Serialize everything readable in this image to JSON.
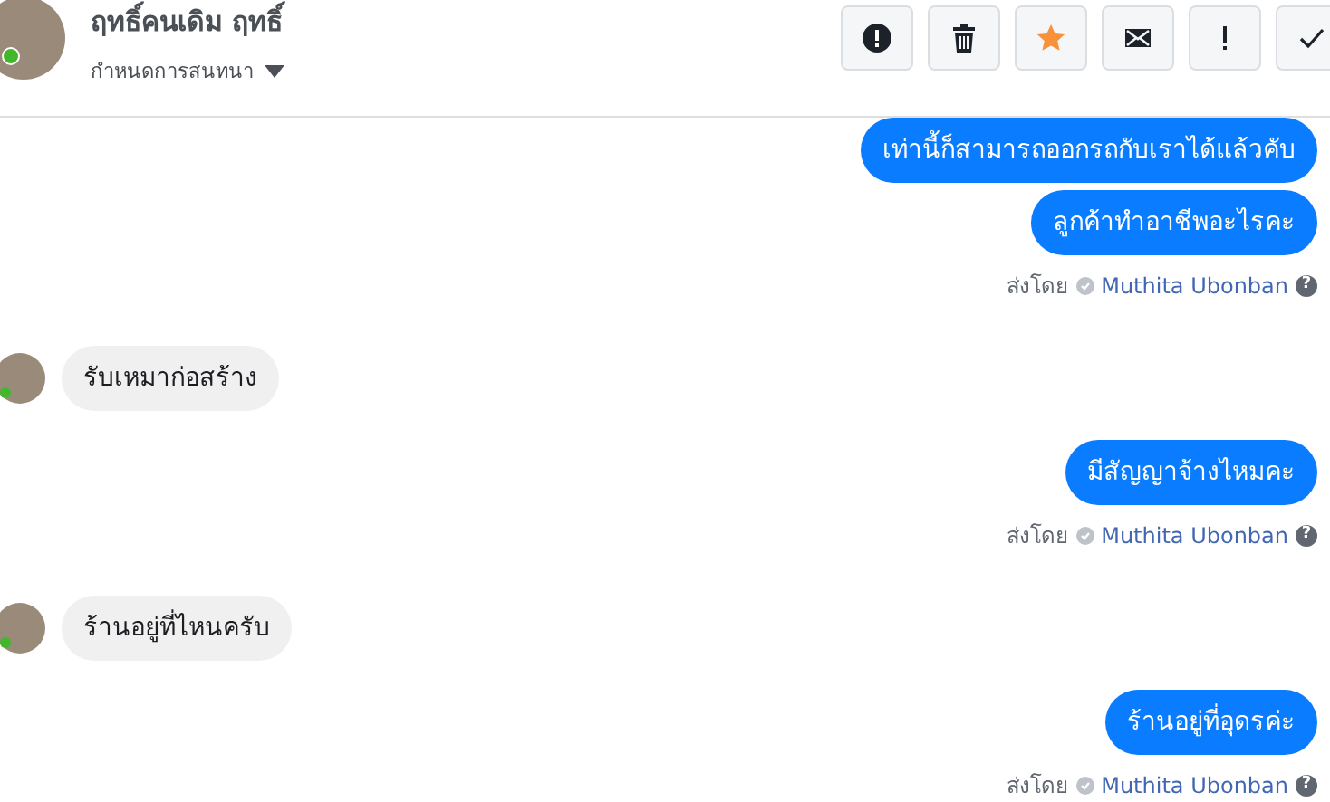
{
  "header": {
    "name": "ฤทธิ์คนเดิม ฤทธิ์",
    "subtitle": "กำหนดการสนทนา",
    "online": true
  },
  "actions": [
    {
      "kind": "alert",
      "active": false
    },
    {
      "kind": "trash",
      "active": false
    },
    {
      "kind": "star",
      "active": true
    },
    {
      "kind": "mail",
      "active": false
    },
    {
      "kind": "exclaim",
      "active": false
    },
    {
      "kind": "check",
      "active": false
    }
  ],
  "messages": [
    {
      "kind": "sent",
      "text": "เท่านี้ก็สามารถออกรถกับเราได้แล้วคับ"
    },
    {
      "kind": "sent",
      "text": "ลูกค้าทำอาชีพอะไรคะ",
      "sent_by": {
        "prefix": "ส่งโดย",
        "name": "Muthita Ubonban",
        "help": "?"
      }
    },
    {
      "kind": "received",
      "text": "รับเหมาก่อสร้าง"
    },
    {
      "kind": "sent",
      "text": "มีสัญญาจ้างไหมคะ",
      "sent_by": {
        "prefix": "ส่งโดย",
        "name": "Muthita Ubonban",
        "help": "?"
      }
    },
    {
      "kind": "received",
      "text": "ร้านอยู่ที่ไหนครับ"
    },
    {
      "kind": "sent",
      "text": "ร้านอยู่ที่อุดรค่ะ",
      "sent_by": {
        "prefix": "ส่งโดย",
        "name": "Muthita Ubonban",
        "help": "?"
      }
    }
  ]
}
